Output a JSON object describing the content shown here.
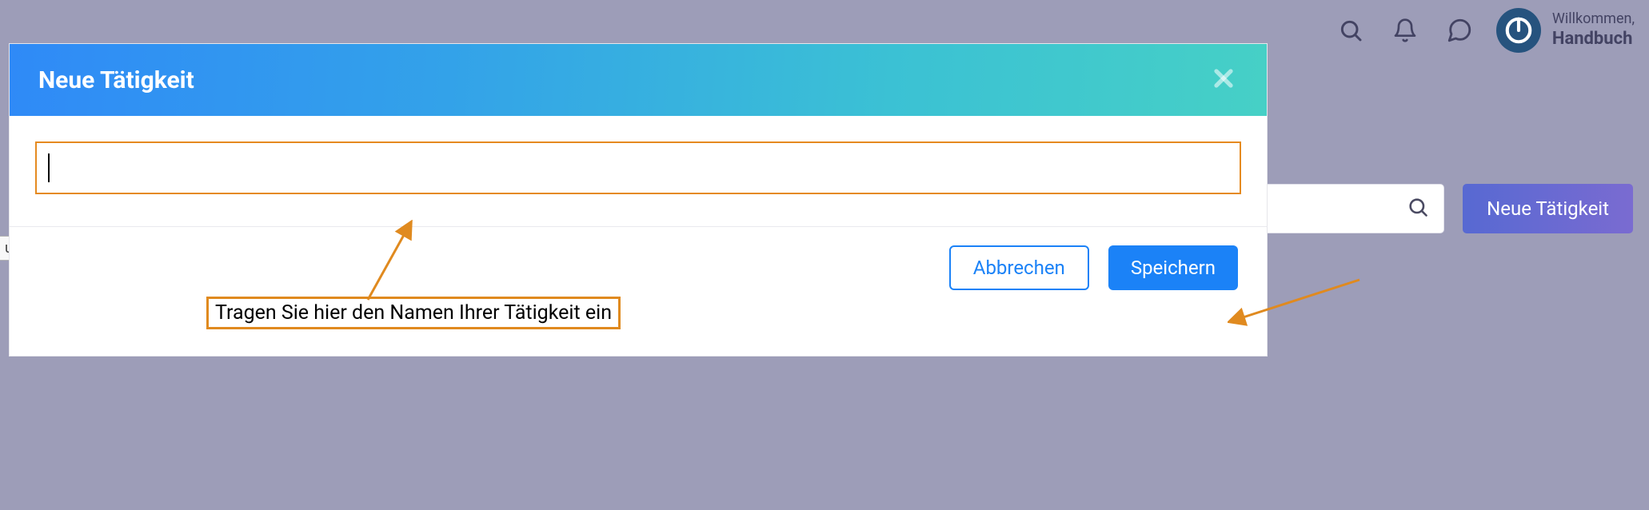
{
  "header": {
    "welcome_label": "Willkommen,",
    "user_name": "Handbuch"
  },
  "toolbar": {
    "new_activity_label": "Neue Tätigkeit"
  },
  "tooltip_fragment": "ung",
  "modal": {
    "title": "Neue Tätigkeit",
    "input_value": "",
    "cancel_label": "Abbrechen",
    "save_label": "Speichern"
  },
  "annotation": {
    "hint_text": "Tragen Sie hier den Namen Ihrer Tätigkeit ein"
  }
}
